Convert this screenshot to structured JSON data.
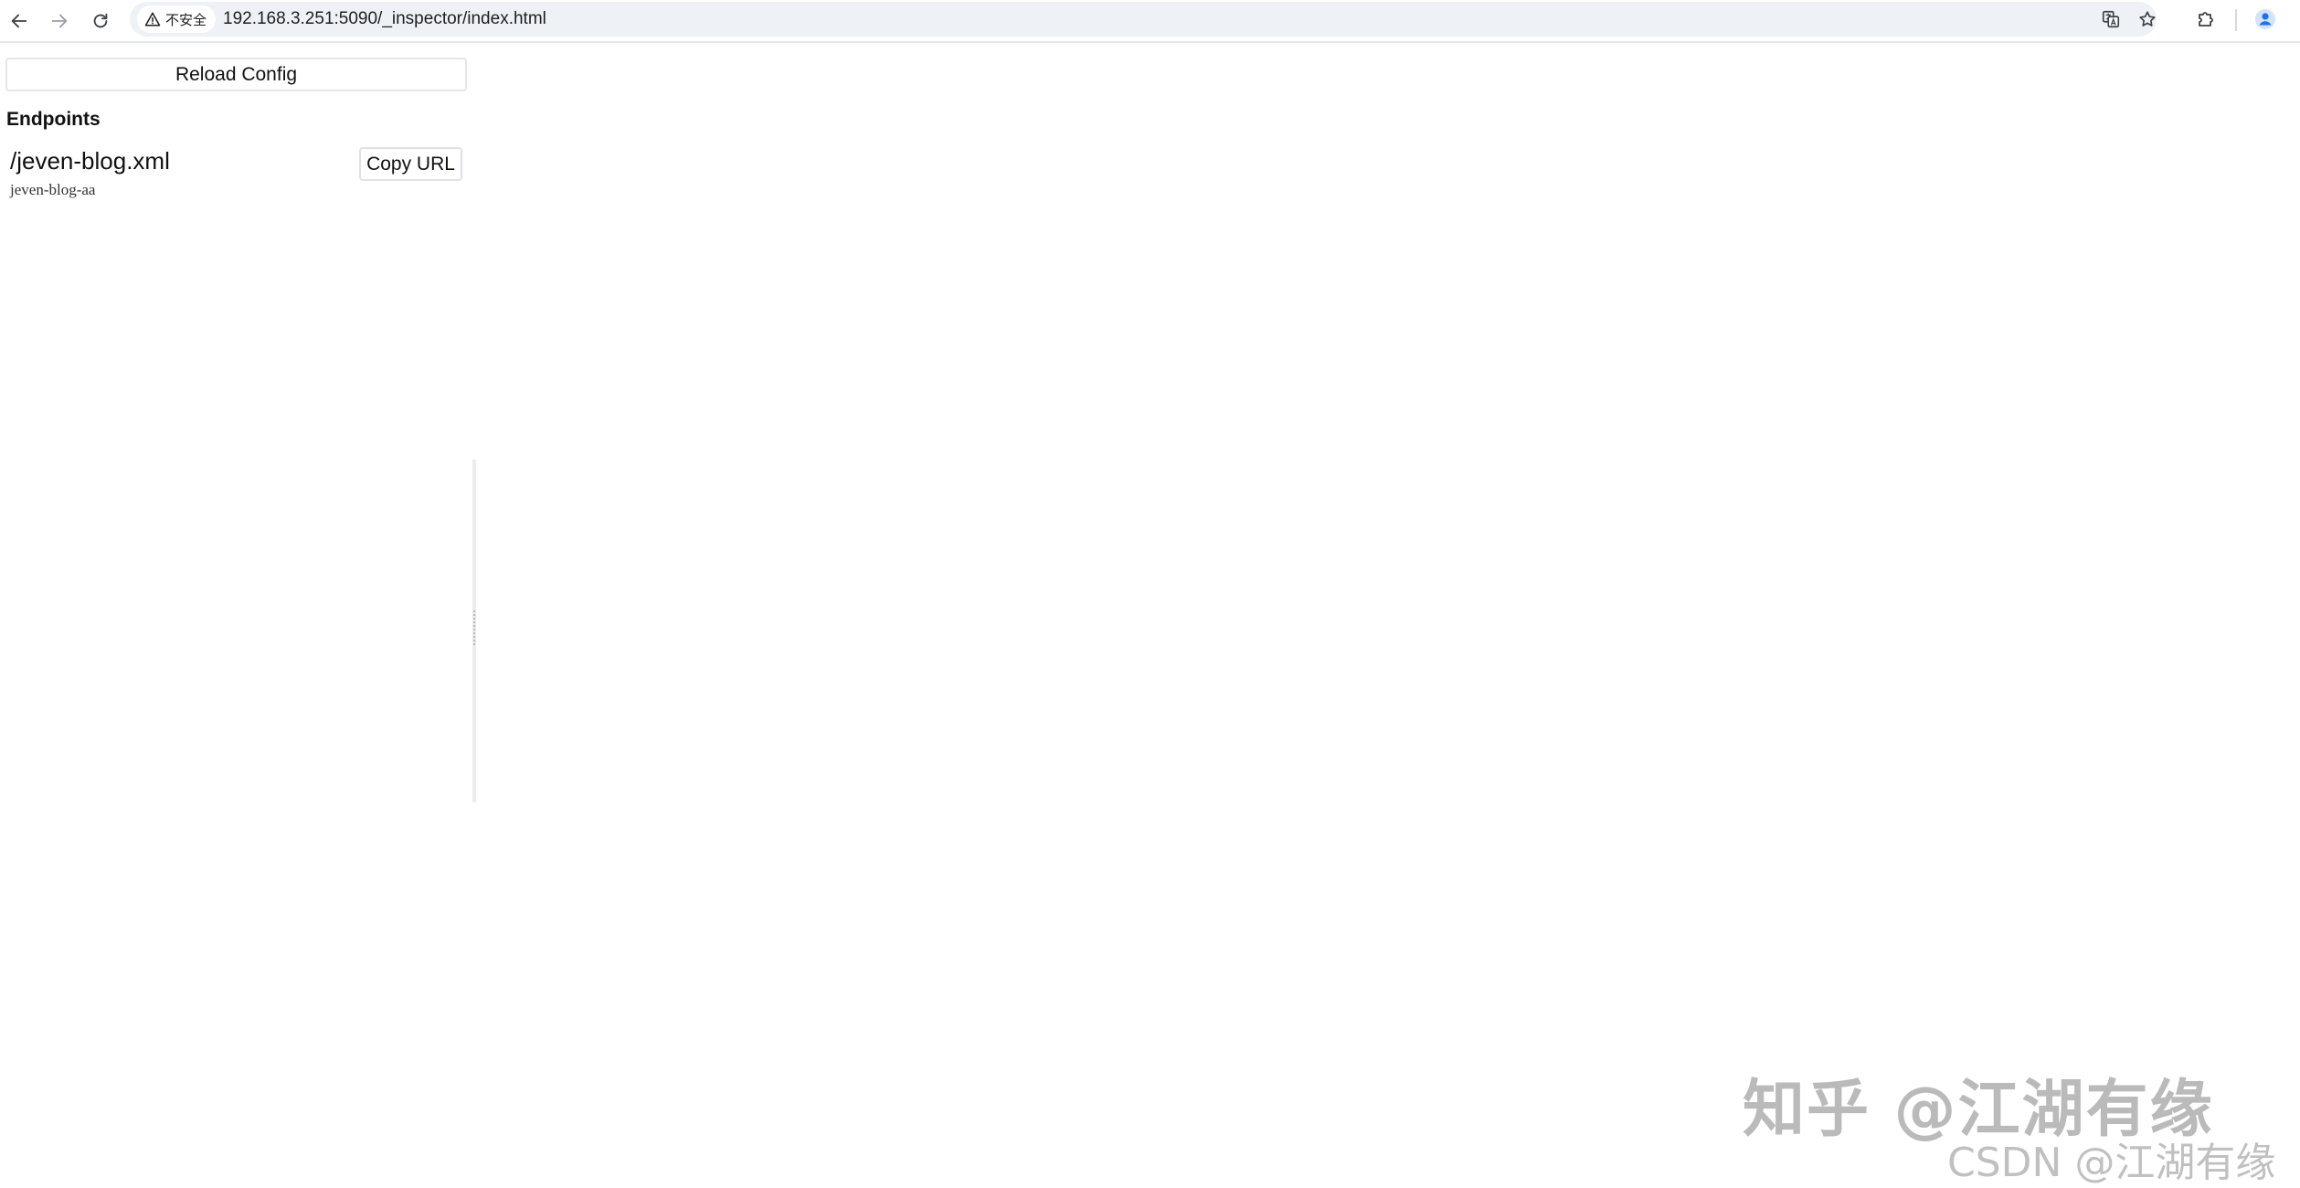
{
  "browser": {
    "security_label": "不安全",
    "url": "192.168.3.251:5090/_inspector/index.html",
    "icons": {
      "back": "arrow-left-icon",
      "forward": "arrow-right-icon",
      "reload": "reload-icon",
      "security": "warning-triangle-icon",
      "translate": "translate-icon",
      "bookmark": "star-icon",
      "extensions": "puzzle-icon",
      "profile": "profile-avatar-icon"
    },
    "accent_color": "#1a73e8"
  },
  "page": {
    "reload_button_label": "Reload Config",
    "endpoints_title": "Endpoints",
    "endpoints": [
      {
        "path": "/jeven-blog.xml",
        "name": "jeven-blog-aa",
        "copy_label": "Copy URL"
      }
    ]
  },
  "watermark": {
    "main": "知乎 @江湖有缘",
    "sub": "CSDN @江湖有缘"
  }
}
